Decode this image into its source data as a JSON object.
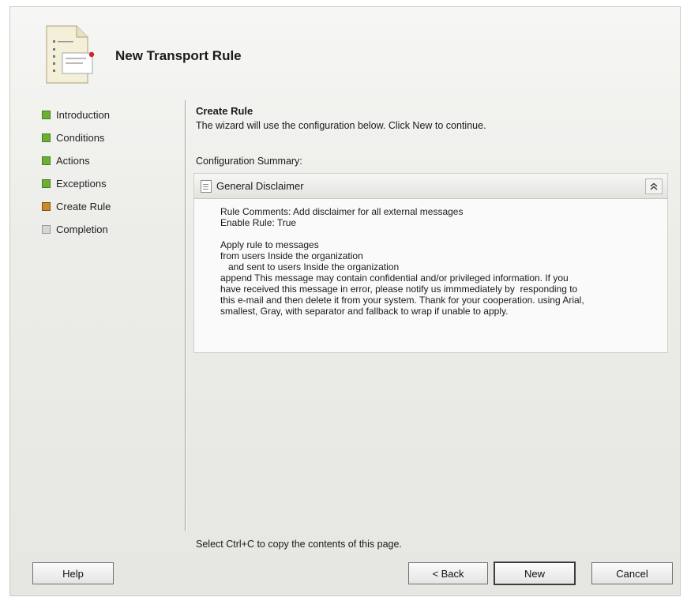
{
  "window": {
    "title": "New Transport Rule"
  },
  "steps": [
    {
      "label": "Introduction",
      "state": "done"
    },
    {
      "label": "Conditions",
      "state": "done"
    },
    {
      "label": "Actions",
      "state": "done"
    },
    {
      "label": "Exceptions",
      "state": "done"
    },
    {
      "label": "Create Rule",
      "state": "current"
    },
    {
      "label": "Completion",
      "state": "pending"
    }
  ],
  "main": {
    "section_title": "Create Rule",
    "intro": "The wizard will use the configuration below.  Click New to continue.",
    "summary_label": "Configuration Summary:",
    "panel": {
      "name": "General Disclaimer",
      "collapse_glyph": "»",
      "lines": [
        "Rule Comments: Add disclaimer for all external messages",
        "Enable Rule: True",
        "",
        "Apply rule to messages",
        "from users Inside the organization",
        "   and sent to users Inside the organization",
        "append This message may contain confidential and/or privileged information. If you",
        "have received this message in error, please notify us immmediately by  responding to",
        "this e-mail and then delete it from your system. Thank for your cooperation. using Arial,",
        "smallest, Gray, with separator and fallback to wrap if unable to apply."
      ]
    },
    "footer_hint": "Select Ctrl+C to copy the contents of this page."
  },
  "buttons": {
    "help": "Help",
    "back": "< Back",
    "new": "New",
    "cancel": "Cancel"
  },
  "colors": {
    "step_done": "#6ab033",
    "step_current": "#c98b2a",
    "step_pending": "#d6d6d6"
  },
  "icons": {
    "header": "wizard-document-icon",
    "panel": "document-icon",
    "collapse": "chevron-up-double-icon"
  }
}
